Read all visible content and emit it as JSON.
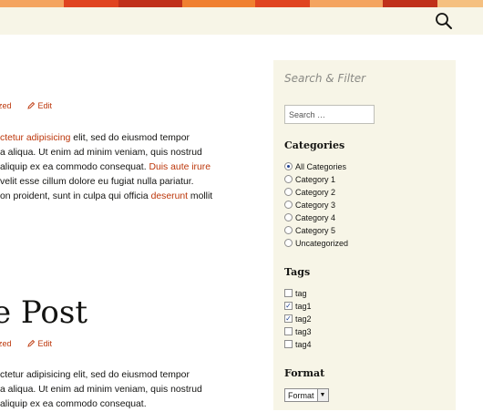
{
  "header": {
    "search_icon": "search-icon",
    "banner_colors": [
      "#e04420",
      "#f08030",
      "#c0301a",
      "#f4a460",
      "#e86a30"
    ],
    "nav_background": "#f7f5e7"
  },
  "posts": [
    {
      "meta_category": "zed",
      "edit_label": "Edit",
      "paragraph": {
        "line1_link": "ctetur adipisicing",
        "line1_text": " elit, sed do eiusmod tempor",
        "line2": "a aliqua. Ut enim ad minim veniam, quis nostrud",
        "line3_text": "aliquip ex ea commodo consequat. ",
        "line3_link": "Duis aute irure",
        "line4": "velit esse cillum dolore eu fugiat nulla pariatur.",
        "line5_text": "on proident, sunt in culpa qui officia ",
        "line5_link": "deserunt",
        "line5_tail": " mollit"
      }
    },
    {
      "title": "e Post",
      "meta_category": "zed",
      "edit_label": "Edit",
      "paragraph": {
        "line1": "ctetur adipisicing elit, sed do eiusmod tempor",
        "line2": "a aliqua. Ut enim ad minim veniam, quis nostrud",
        "line3": "aliquip ex ea commodo consequat."
      }
    }
  ],
  "sidebar": {
    "search_title": "Search & Filter",
    "search_placeholder": "Search …",
    "categories_title": "Categories",
    "categories": [
      "All Categories",
      "Category 1",
      "Category 2",
      "Category 3",
      "Category 4",
      "Category 5",
      "Uncategorized"
    ],
    "categories_selected": "All Categories",
    "tags_title": "Tags",
    "tags": [
      {
        "label": "tag",
        "checked": false
      },
      {
        "label": "tag1",
        "checked": true
      },
      {
        "label": "tag2",
        "checked": true
      },
      {
        "label": "tag3",
        "checked": false
      },
      {
        "label": "tag4",
        "checked": false
      }
    ],
    "format_title": "Format",
    "format_selected": "Format"
  }
}
